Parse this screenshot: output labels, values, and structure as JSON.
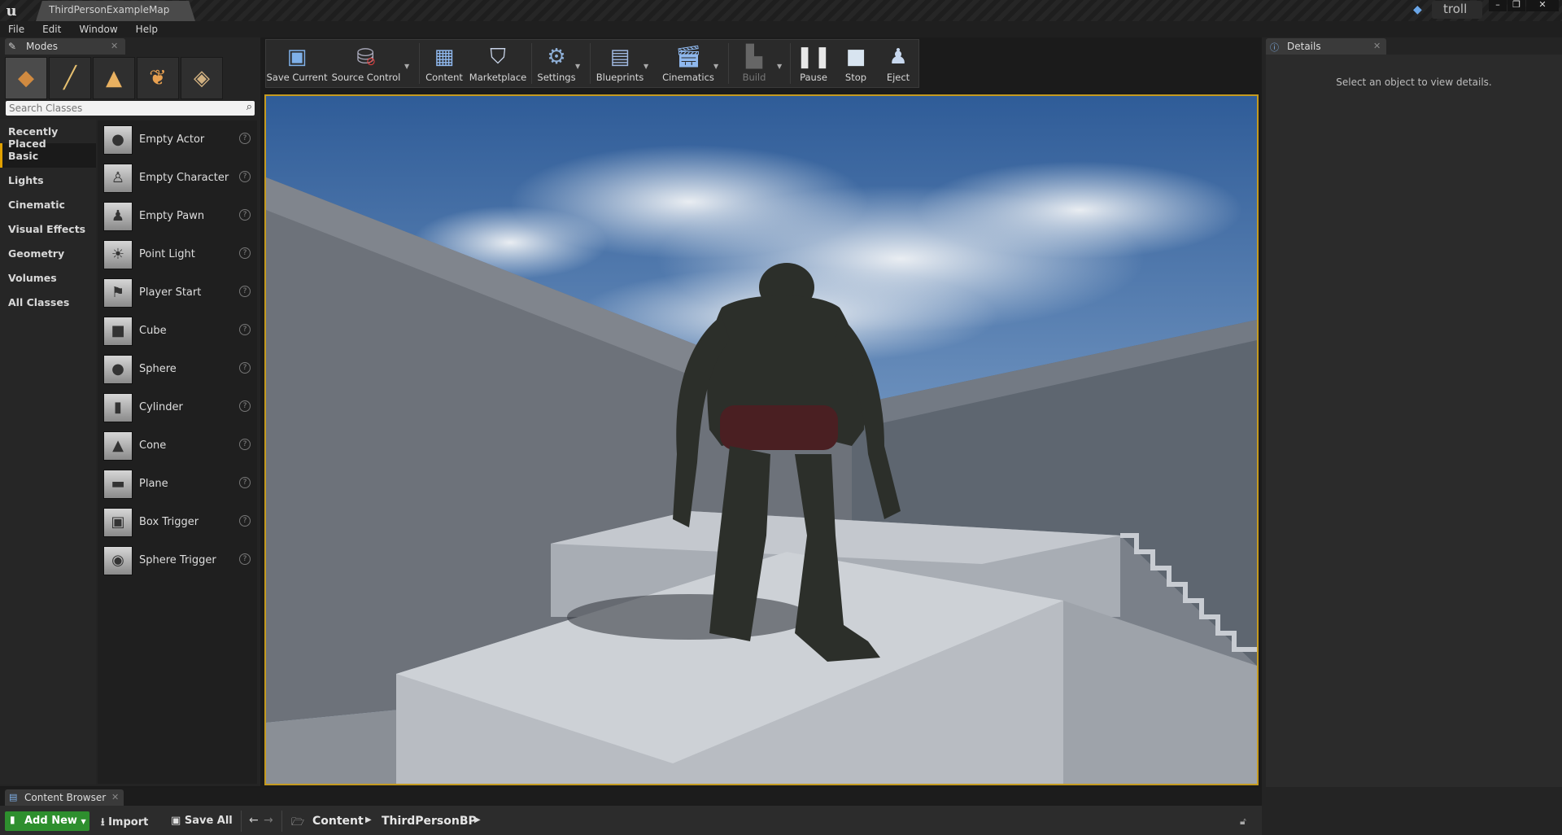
{
  "window": {
    "tab_title": "ThirdPersonExampleMap",
    "user": "troll",
    "buttons": {
      "minimize": "–",
      "restore": "❐",
      "close": "✕"
    }
  },
  "menu": [
    "File",
    "Edit",
    "Window",
    "Help"
  ],
  "modes": {
    "tab_label": "Modes",
    "mode_icons": [
      "place-mode-icon",
      "paint-mode-icon",
      "landscape-mode-icon",
      "foliage-mode-icon",
      "geometry-mode-icon"
    ],
    "search_placeholder": "Search Classes",
    "categories": [
      "Recently Placed",
      "Basic",
      "Lights",
      "Cinematic",
      "Visual Effects",
      "Geometry",
      "Volumes",
      "All Classes"
    ],
    "active_category": "Basic",
    "items": [
      {
        "label": "Empty Actor",
        "icon": "sphere-icon"
      },
      {
        "label": "Empty Character",
        "icon": "character-icon"
      },
      {
        "label": "Empty Pawn",
        "icon": "pawn-icon"
      },
      {
        "label": "Point Light",
        "icon": "bulb-icon"
      },
      {
        "label": "Player Start",
        "icon": "flag-icon"
      },
      {
        "label": "Cube",
        "icon": "cube-icon"
      },
      {
        "label": "Sphere",
        "icon": "sphere-icon"
      },
      {
        "label": "Cylinder",
        "icon": "cylinder-icon"
      },
      {
        "label": "Cone",
        "icon": "cone-icon"
      },
      {
        "label": "Plane",
        "icon": "plane-icon"
      },
      {
        "label": "Box Trigger",
        "icon": "box-trigger-icon"
      },
      {
        "label": "Sphere Trigger",
        "icon": "sphere-trigger-icon"
      }
    ]
  },
  "toolbar": {
    "save_current": "Save Current",
    "source_control": "Source Control",
    "content": "Content",
    "marketplace": "Marketplace",
    "settings": "Settings",
    "blueprints": "Blueprints",
    "cinematics": "Cinematics",
    "build": "Build",
    "pause": "Pause",
    "stop": "Stop",
    "eject": "Eject"
  },
  "details": {
    "tab_label": "Details",
    "empty_message": "Select an object to view details."
  },
  "content_browser": {
    "tab_label": "Content Browser",
    "add_new": "Add New",
    "import": "Import",
    "save_all": "Save All",
    "breadcrumb": [
      "Content",
      "ThirdPersonBP"
    ]
  },
  "colors": {
    "accent": "#c49a20",
    "add_new_green": "#2e8f2e",
    "panel": "#242424"
  }
}
